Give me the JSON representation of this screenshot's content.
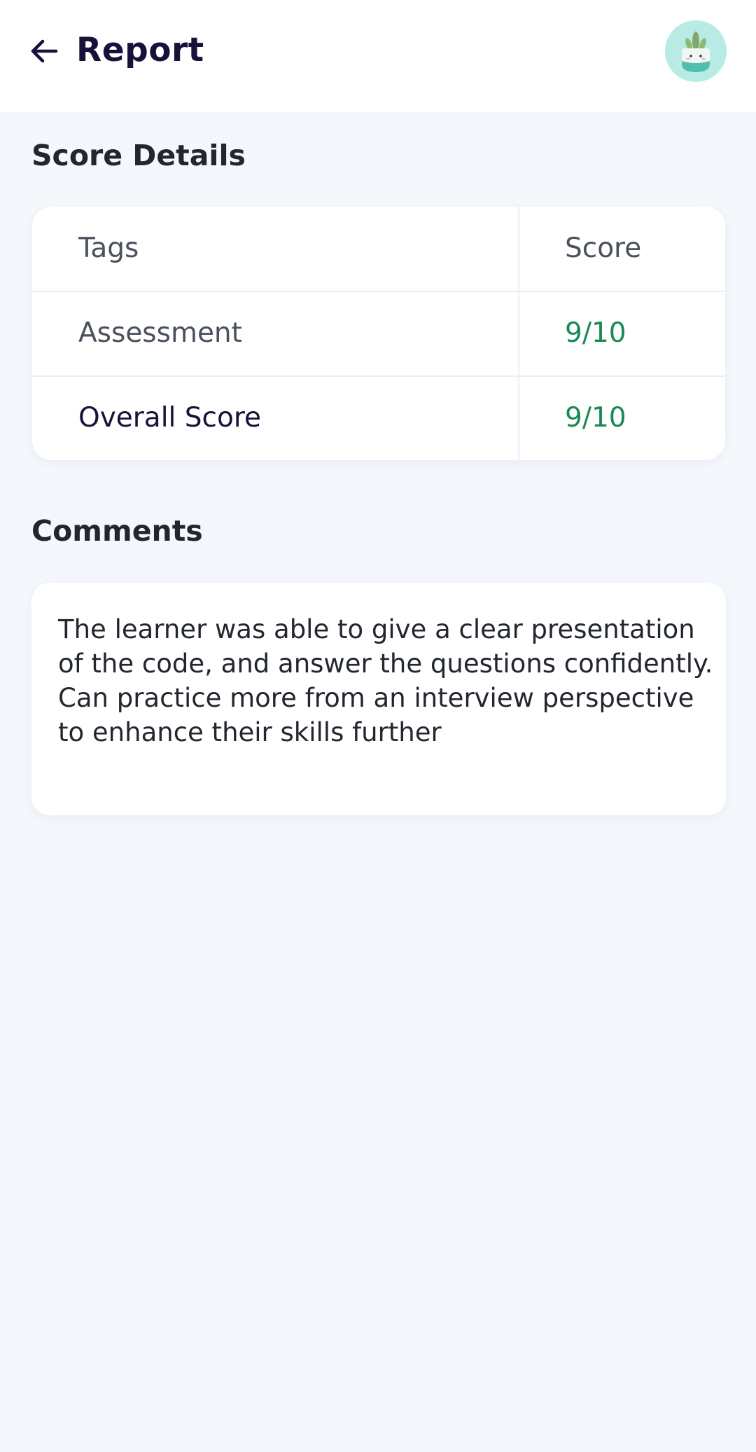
{
  "header": {
    "title": "Report",
    "back_icon": "arrow-left-icon",
    "avatar_icon": "plant-avatar-icon"
  },
  "score_details": {
    "title": "Score Details",
    "columns": [
      "Tags",
      "Score"
    ],
    "rows": [
      {
        "tag": "Assessment",
        "score": "9/10"
      }
    ],
    "overall": {
      "tag": "Overall Score",
      "score": "9/10"
    }
  },
  "comments": {
    "title": "Comments",
    "text": "The learner was able to give a clear presentation of the code, and answer the questions confidently. Can practice more from an interview perspective to enhance their skills further"
  },
  "colors": {
    "background": "#f4f8fc",
    "title_text": "#17123a",
    "score_green": "#1a8a55",
    "avatar_bg": "#b8ebe4"
  }
}
